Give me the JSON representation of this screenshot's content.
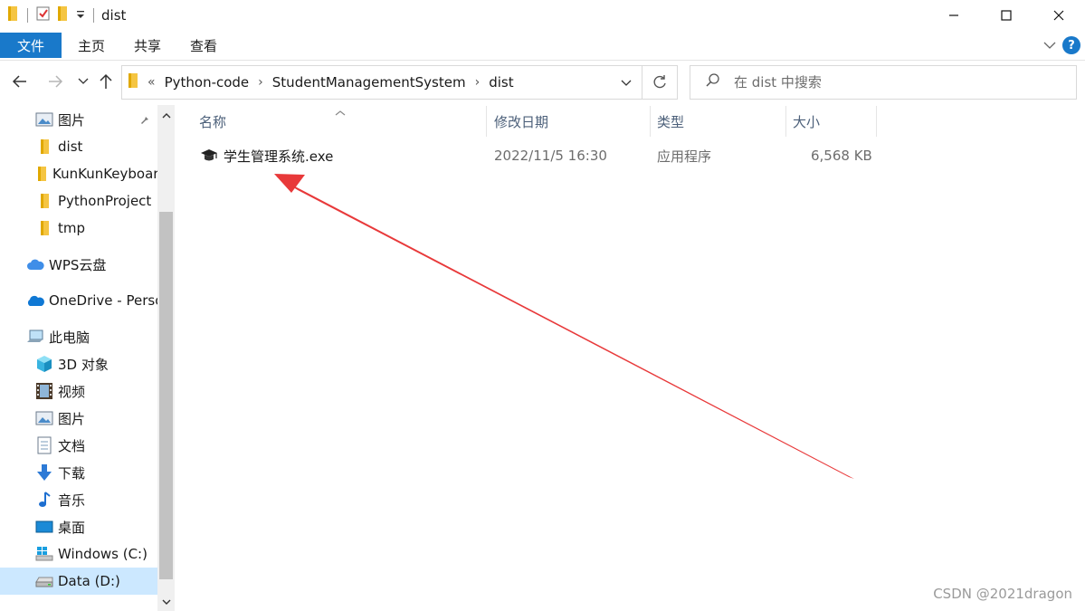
{
  "window": {
    "title": "dist"
  },
  "ribbon": {
    "file_tab": "文件",
    "tabs": [
      "主页",
      "共享",
      "查看"
    ]
  },
  "address": {
    "overflow": "«",
    "crumbs": [
      "Python-code",
      "StudentManagementSystem",
      "dist"
    ]
  },
  "search": {
    "placeholder": "在 dist 中搜索"
  },
  "sidebar": {
    "items": [
      {
        "label": "图片",
        "icon": "pictures-icon",
        "pinned": true
      },
      {
        "label": "dist",
        "icon": "folder-icon"
      },
      {
        "label": "KunKunKeyboard",
        "icon": "folder-icon"
      },
      {
        "label": "PythonProject",
        "icon": "folder-icon"
      },
      {
        "label": "tmp",
        "icon": "folder-icon"
      },
      {
        "label": "WPS云盘",
        "icon": "cloud-icon"
      },
      {
        "label": "OneDrive - Personal",
        "icon": "onedrive-icon"
      },
      {
        "label": "此电脑",
        "icon": "computer-icon"
      },
      {
        "label": "3D 对象",
        "icon": "3d-objects-icon"
      },
      {
        "label": "视频",
        "icon": "videos-icon"
      },
      {
        "label": "图片",
        "icon": "pictures-icon"
      },
      {
        "label": "文档",
        "icon": "documents-icon"
      },
      {
        "label": "下载",
        "icon": "downloads-icon"
      },
      {
        "label": "音乐",
        "icon": "music-icon"
      },
      {
        "label": "桌面",
        "icon": "desktop-icon"
      },
      {
        "label": "Windows (C:)",
        "icon": "windows-drive-icon"
      },
      {
        "label": "Data (D:)",
        "icon": "drive-icon",
        "selected": true
      }
    ]
  },
  "columns": {
    "name": "名称",
    "modified": "修改日期",
    "type": "类型",
    "size": "大小"
  },
  "files": [
    {
      "name": "学生管理系统.exe",
      "modified": "2022/11/5 16:30",
      "type": "应用程序",
      "size": "6,568 KB",
      "icon": "graduation-cap-icon"
    }
  ],
  "annotation": {
    "arrow_color": "#e8393a"
  },
  "watermark": "CSDN @2021dragon"
}
